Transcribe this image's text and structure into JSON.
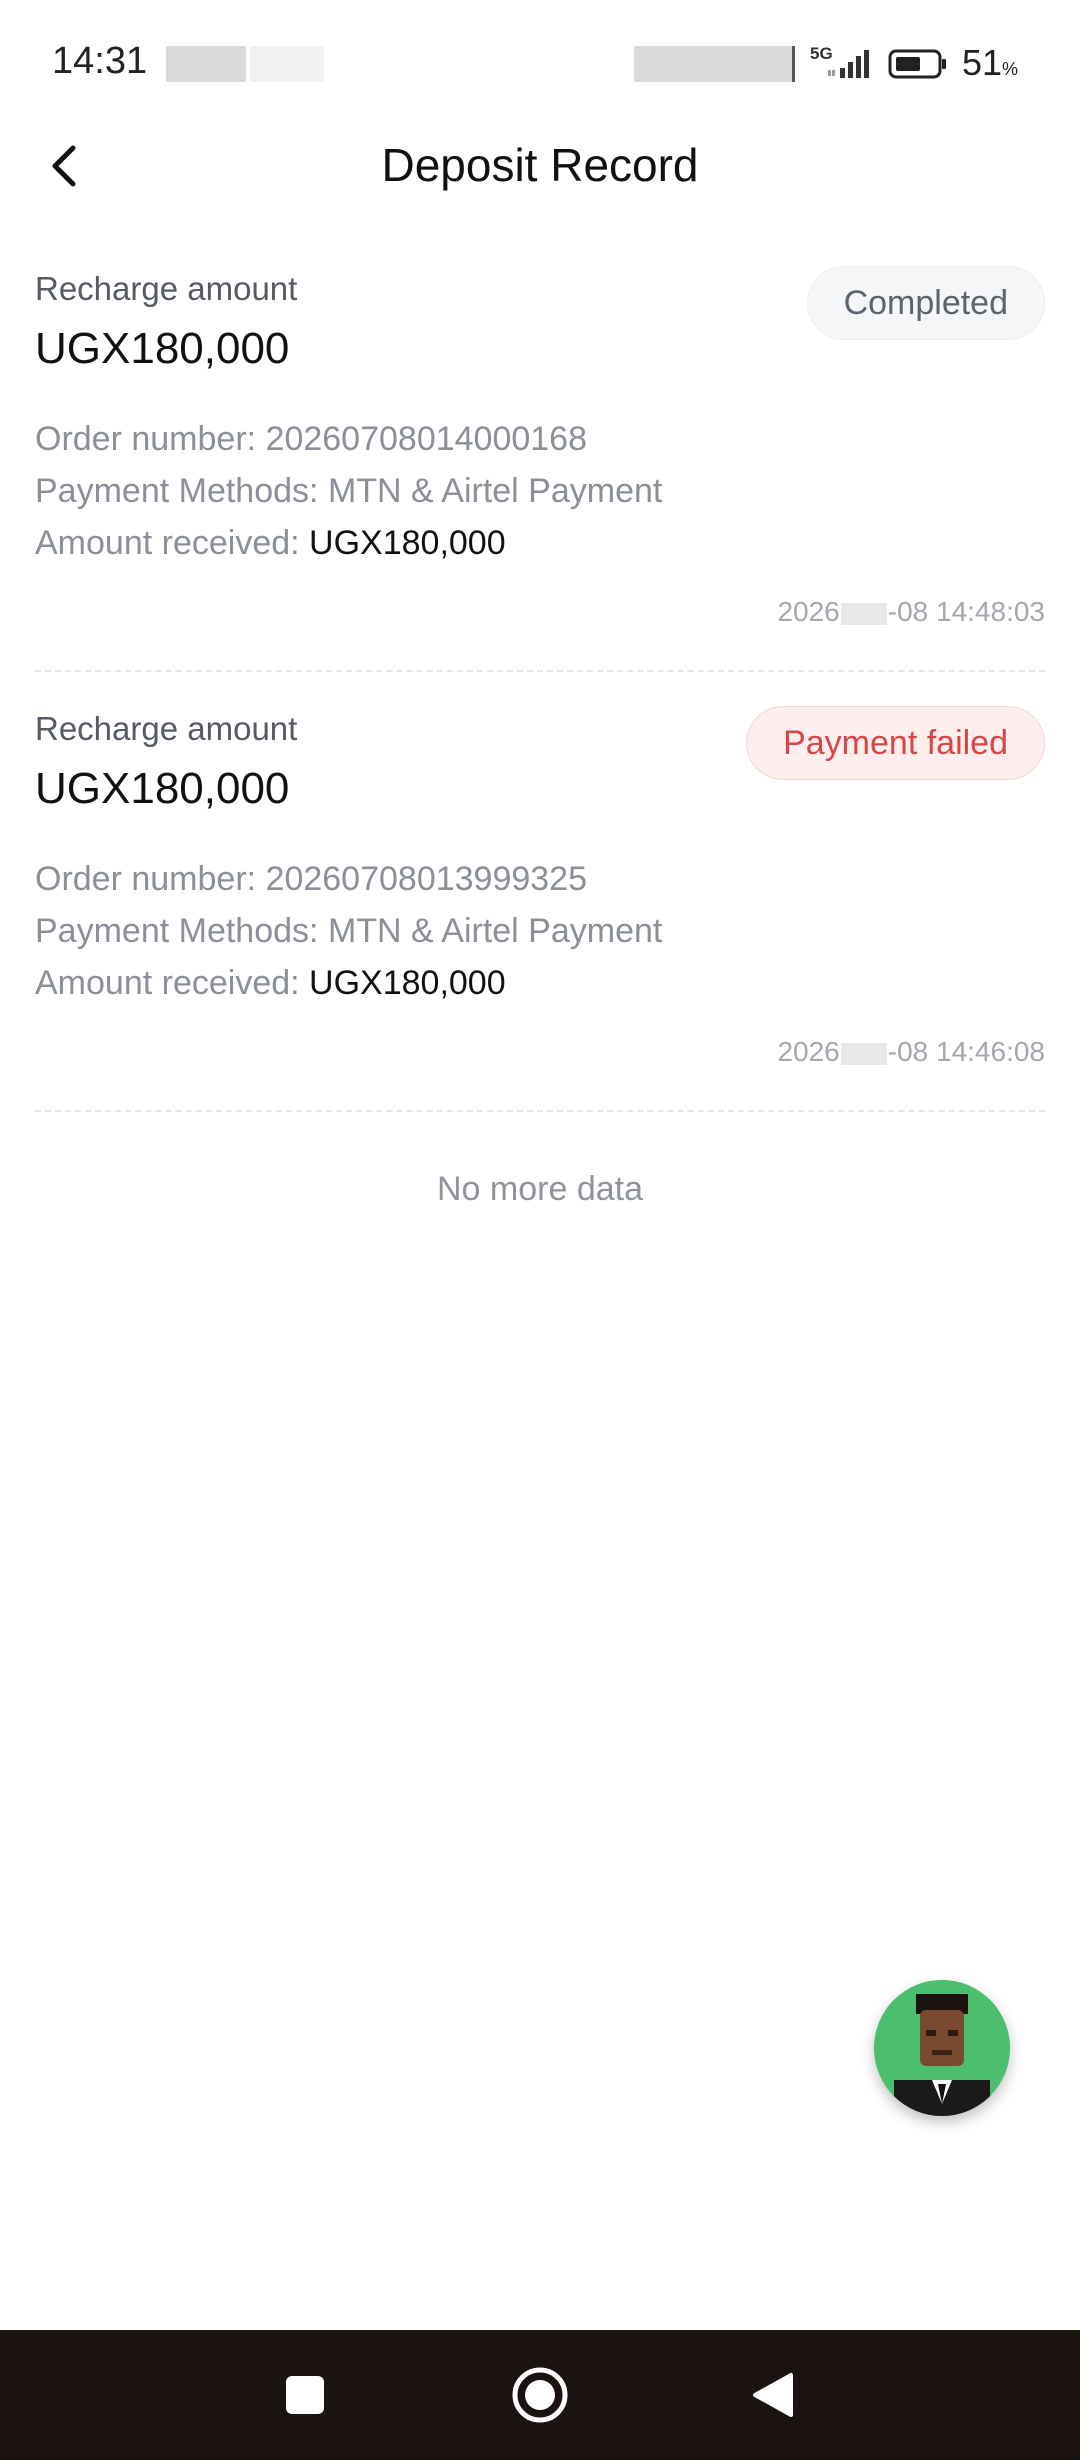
{
  "status_bar": {
    "time": "14:31",
    "network": "5G",
    "battery_percent": "51",
    "battery_unit": "%",
    "icons": [
      "signal-icon",
      "battery-icon"
    ]
  },
  "header": {
    "title": "Deposit Record",
    "back_icon": "chevron-left-icon"
  },
  "records": [
    {
      "label": "Recharge amount",
      "amount": "UGX180,000",
      "status": "Completed",
      "status_color": "#5d6470",
      "order_label": "Order number:",
      "order_number": "20260708014000168",
      "method_label": "Payment Methods:",
      "method": "MTN & Airtel Payment",
      "received_label": "Amount received:",
      "received": "UGX180,000",
      "time_prefix": "2026",
      "time_suffix": "-08 14:48:03"
    },
    {
      "label": "Recharge amount",
      "amount": "UGX180,000",
      "status": "Payment failed",
      "status_color": "#d94545",
      "order_label": "Order number:",
      "order_number": "20260708013999325",
      "method_label": "Payment Methods:",
      "method": "MTN & Airtel Payment",
      "received_label": "Amount received:",
      "received": "UGX180,000",
      "time_prefix": "2026",
      "time_suffix": "-08 14:46:08"
    }
  ],
  "footer_text": "No more data",
  "floating_button": {
    "icon": "support-avatar-icon"
  },
  "nav_bar": {
    "icons": [
      "recents-square-icon",
      "home-circle-icon",
      "back-triangle-icon"
    ]
  },
  "colors": {
    "failed": "#d94545",
    "nav_bg": "#1b1212",
    "avatar_bg": "#4cbf6e"
  }
}
